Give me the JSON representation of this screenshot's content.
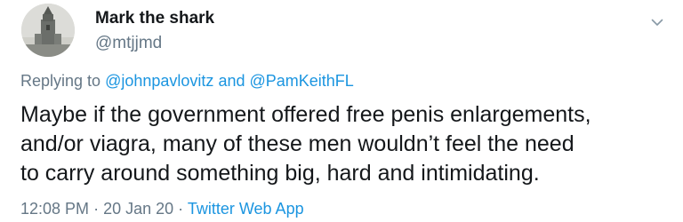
{
  "tweet": {
    "author": {
      "display_name": "Mark the shark",
      "handle": "@mtjjmd"
    },
    "menu_icon": "chevron-down-icon",
    "reply": {
      "prefix": "Replying to",
      "mention_1": "@johnpavlovitz",
      "connector": "and",
      "mention_2": "@PamKeithFL"
    },
    "text_lines": [
      "Maybe if the government offered free penis enlargements,",
      "and/or viagra, many of these men wouldn’t feel the need",
      "to carry around something big, hard and intimidating."
    ],
    "meta": {
      "time": "12:08 PM",
      "separator": "·",
      "date": "20 Jan 20",
      "source": "Twitter Web App"
    }
  },
  "colors": {
    "text": "#14171a",
    "secondary": "#657786",
    "link": "#1b95e0"
  }
}
